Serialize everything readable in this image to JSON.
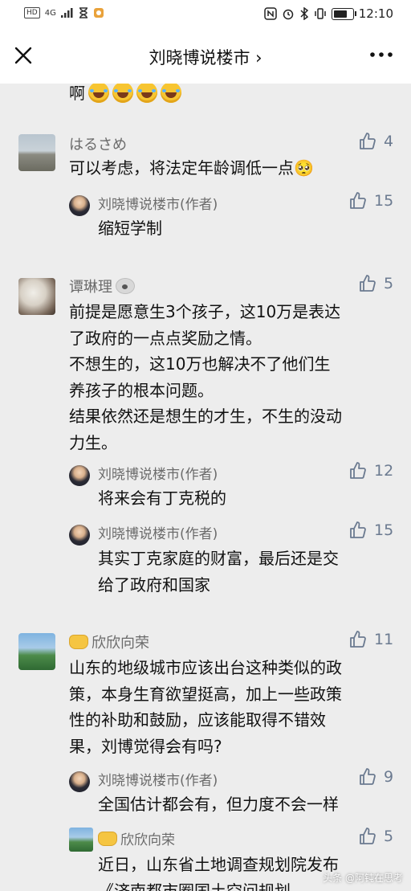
{
  "status": {
    "left_badge": "HD",
    "network": "4G",
    "time": "12:10"
  },
  "nav": {
    "title": "刘晓博说楼市 ›"
  },
  "top_fragment": {
    "text": "啊"
  },
  "comments": [
    {
      "name": "はるさめ",
      "likes": "4",
      "text": "可以考虑，将法定年龄调低一点🥺",
      "replies": [
        {
          "name": "刘晓博说楼市(作者)",
          "likes": "15",
          "text": "缩短学制"
        }
      ]
    },
    {
      "name": "谭琳理",
      "likes": "5",
      "text_lines": [
        "前提是愿意生3个孩子，这10万是表达",
        "了政府的一点点奖励之情。",
        "不想生的，这10万也解决不了他们生",
        "养孩子的根本问题。",
        "结果依然还是想生的才生，不生的没动",
        "力生。"
      ],
      "replies": [
        {
          "name": "刘晓博说楼市(作者)",
          "likes": "12",
          "text": "将来会有丁克税的"
        },
        {
          "name": "刘晓博说楼市(作者)",
          "likes": "15",
          "text_lines": [
            "其实丁克家庭的财富，最后还是交",
            "给了政府和国家"
          ]
        }
      ]
    },
    {
      "name": "欣欣向荣",
      "likes": "11",
      "text_lines": [
        "山东的地级城市应该出台这种类似的政",
        "策，本身生育欲望挺高，加上一些政策",
        "性的补助和鼓励，应该能取得不错效",
        "果，刘博觉得会有吗?"
      ],
      "replies": [
        {
          "name": "刘晓博说楼市(作者)",
          "likes": "9",
          "text": "全国估计都会有，但力度不会一样"
        },
        {
          "name": "欣欣向荣",
          "likes": "5",
          "text_lines": [
            "近日，山东省土地调查规划院发布",
            "《济南都市圈国土空间规划"
          ]
        }
      ]
    }
  ],
  "watermark": "头条 @阿钝在思考"
}
